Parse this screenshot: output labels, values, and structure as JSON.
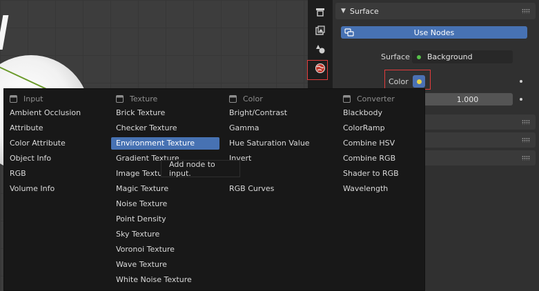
{
  "properties": {
    "panel_title": "Surface",
    "use_nodes_label": "Use Nodes",
    "surface_label": "Surface",
    "surface_value": "Background",
    "color_label": "Color",
    "strength_value": "1.000"
  },
  "menu": {
    "columns": [
      {
        "header": "Input",
        "items": [
          "Ambient Occlusion",
          "Attribute",
          "Color Attribute",
          "Object Info",
          "RGB",
          "Volume Info"
        ]
      },
      {
        "header": "Texture",
        "items": [
          "Brick Texture",
          "Checker Texture",
          "Environment Texture",
          "Gradient Texture",
          "Image Texture",
          "Magic Texture",
          "Noise Texture",
          "Point Density",
          "Sky Texture",
          "Voronoi Texture",
          "Wave Texture",
          "White Noise Texture"
        ]
      },
      {
        "header": "Color",
        "items": [
          "Bright/Contrast",
          "Gamma",
          "Hue Saturation Value",
          "Invert",
          "",
          "RGB Curves"
        ]
      },
      {
        "header": "Converter",
        "items": [
          "Blackbody",
          "ColorRamp",
          "Combine HSV",
          "Combine RGB",
          "Shader to RGB",
          "Wavelength"
        ]
      }
    ],
    "selected_item": "Environment Texture"
  },
  "tooltip": {
    "text": "Add node to input."
  },
  "colors": {
    "accent": "#4772b3",
    "highlight_box": "#e43c3c",
    "surface_socket": "#57c14a",
    "color_socket": "#e6d34a"
  },
  "icons": [
    "render-icon",
    "output-icon",
    "view-layer-icon",
    "world-icon",
    "use-nodes-icon",
    "menu-column-icon"
  ]
}
